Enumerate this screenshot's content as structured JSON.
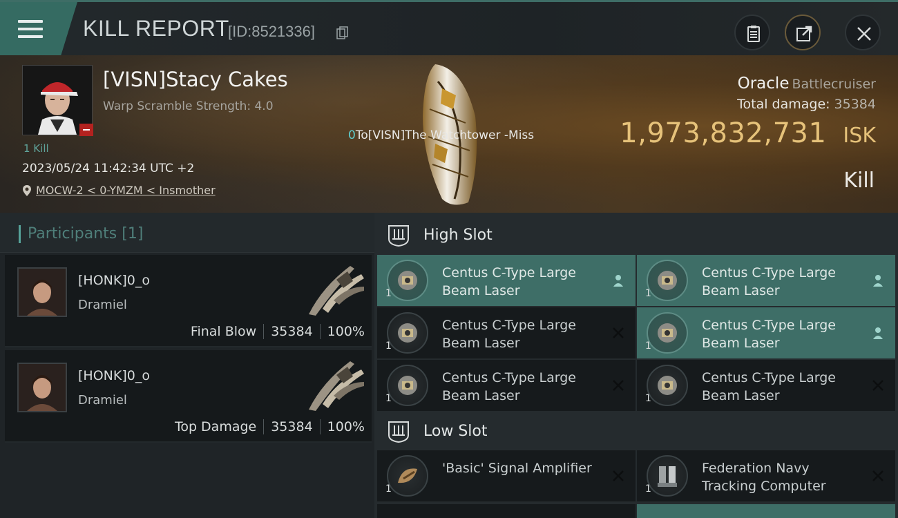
{
  "header": {
    "title": "KILL REPORT",
    "id_text": "[ID:8521336]"
  },
  "victim": {
    "name": "[VISN]Stacy Cakes",
    "warp_scramble": "Warp Scramble Strength: 4.0",
    "kills": "1 Kill",
    "datetime": "2023/05/24 11:42:34 UTC +2",
    "location": "MOCW-2 < 0-YMZM < Insmother"
  },
  "kill_message": {
    "count": "0",
    "text": "To[VISN]The Watchtower -Miss"
  },
  "ship": {
    "name": "Oracle",
    "class": "Battlecruiser",
    "total_damage_label": "Total damage:",
    "total_damage_value": "35384",
    "isk_value": "1,973,832,731",
    "isk_label": "ISK",
    "result": "Kill"
  },
  "participants": {
    "title": "Participants",
    "count": "[1]",
    "items": [
      {
        "name": "[HONK]0_o",
        "ship": "Dramiel",
        "role": "Final Blow",
        "damage": "35384",
        "percent": "100%"
      },
      {
        "name": "[HONK]0_o",
        "ship": "Dramiel",
        "role": "Top Damage",
        "damage": "35384",
        "percent": "100%"
      }
    ]
  },
  "slots": {
    "high": {
      "label": "High Slot",
      "modules": [
        {
          "label": "Centus C-Type Large Beam Laser",
          "qty": "1",
          "state": "fitted",
          "icon": "person-icon"
        },
        {
          "label": "Centus C-Type Large Beam Laser",
          "qty": "1",
          "state": "fitted",
          "icon": "person-icon"
        },
        {
          "label": "Centus C-Type Large Beam Laser",
          "qty": "1",
          "state": "destroyed",
          "icon": "close-icon"
        },
        {
          "label": "Centus C-Type Large Beam Laser",
          "qty": "1",
          "state": "fitted",
          "icon": "person-icon"
        },
        {
          "label": "Centus C-Type Large Beam Laser",
          "qty": "1",
          "state": "destroyed",
          "icon": "close-icon"
        },
        {
          "label": "Centus C-Type Large Beam Laser",
          "qty": "1",
          "state": "destroyed",
          "icon": "close-icon"
        }
      ]
    },
    "low": {
      "label": "Low Slot",
      "modules": [
        {
          "label": "'Basic' Signal Amplifier",
          "qty": "1",
          "state": "destroyed",
          "icon": "close-icon"
        },
        {
          "label": "Federation Navy Tracking Computer",
          "qty": "1",
          "state": "destroyed",
          "icon": "close-icon"
        }
      ]
    }
  },
  "colors": {
    "accent": "#3e6e67",
    "isk": "#e6c27a",
    "participants_title": "#4f7f7a"
  }
}
